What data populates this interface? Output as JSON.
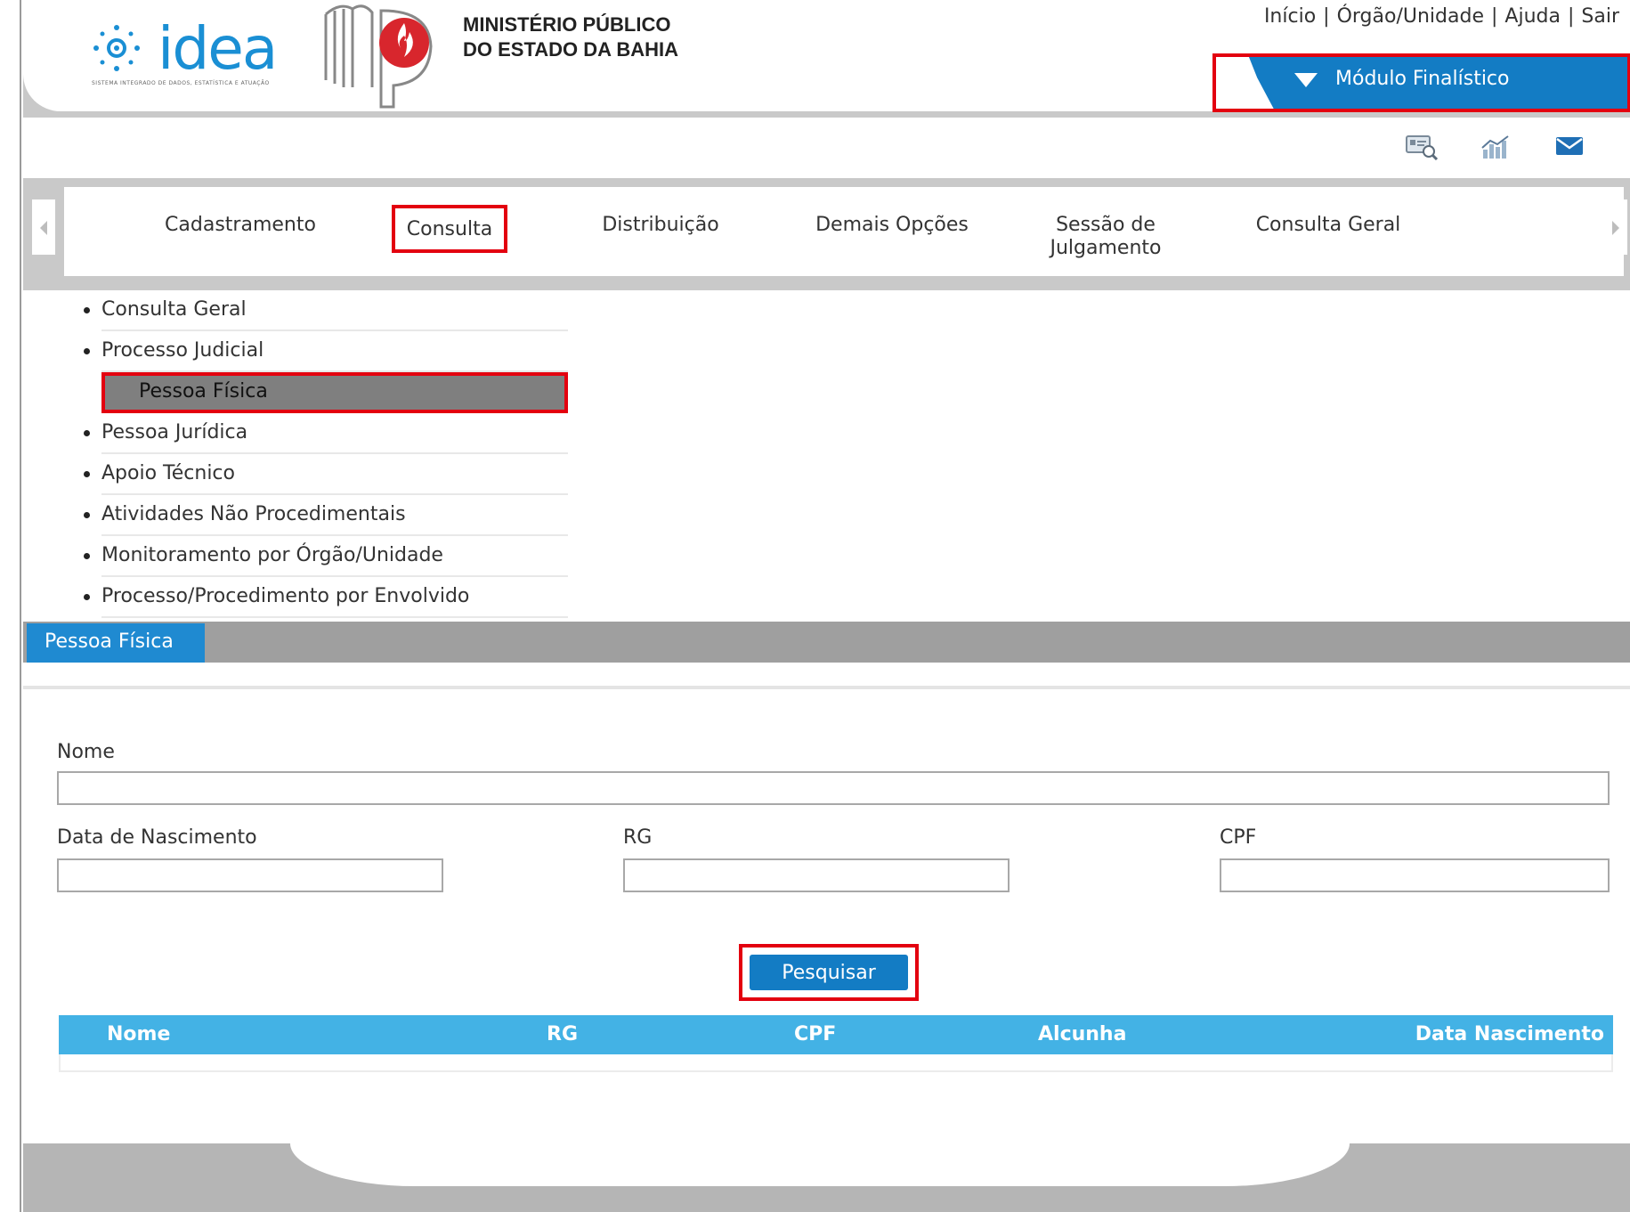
{
  "header": {
    "logo_idea": "idea",
    "logo_idea_tagline": "SISTEMA INTEGRADO DE DADOS, ESTATÍSTICA E ATUAÇÃO",
    "org_name_line1": "MINISTÉRIO PÚBLICO",
    "org_name_line2": "DO ESTADO DA BAHIA",
    "links": [
      "Início",
      "Órgão/Unidade",
      "Ajuda",
      "Sair"
    ],
    "separator": "|",
    "module_label": "Módulo Finalístico",
    "icons": [
      "consulta-icon",
      "stats-icon",
      "mail-icon"
    ]
  },
  "menu": {
    "items": [
      "Cadastramento",
      "Consulta",
      "Distribuição",
      "Demais Opções",
      "Sessão de",
      "Julgamento",
      "Consulta Geral"
    ],
    "active": "Consulta"
  },
  "submenu": {
    "items": [
      "Consulta Geral",
      "Processo Judicial",
      "Pessoa Física",
      "Pessoa Jurídica",
      "Apoio Técnico",
      "Atividades Não Procedimentais",
      "Monitoramento por Órgão/Unidade",
      "Processo/Procedimento por Envolvido"
    ],
    "selected": "Pessoa Física"
  },
  "tab": {
    "label": "Pessoa Física"
  },
  "form": {
    "nome_label": "Nome",
    "nome_value": "",
    "data_label": "Data de Nascimento",
    "data_value": "",
    "rg_label": "RG",
    "rg_value": "",
    "cpf_label": "CPF",
    "cpf_value": "",
    "search_button": "Pesquisar"
  },
  "results": {
    "columns": [
      "Nome",
      "RG",
      "CPF",
      "Alcunha",
      "Data Nascimento"
    ],
    "rows": []
  },
  "colors": {
    "accent_blue": "#137cc4",
    "table_header_blue": "#43b2e5",
    "highlight_red": "#e3000f",
    "tab_blue": "#1f8ad1"
  }
}
